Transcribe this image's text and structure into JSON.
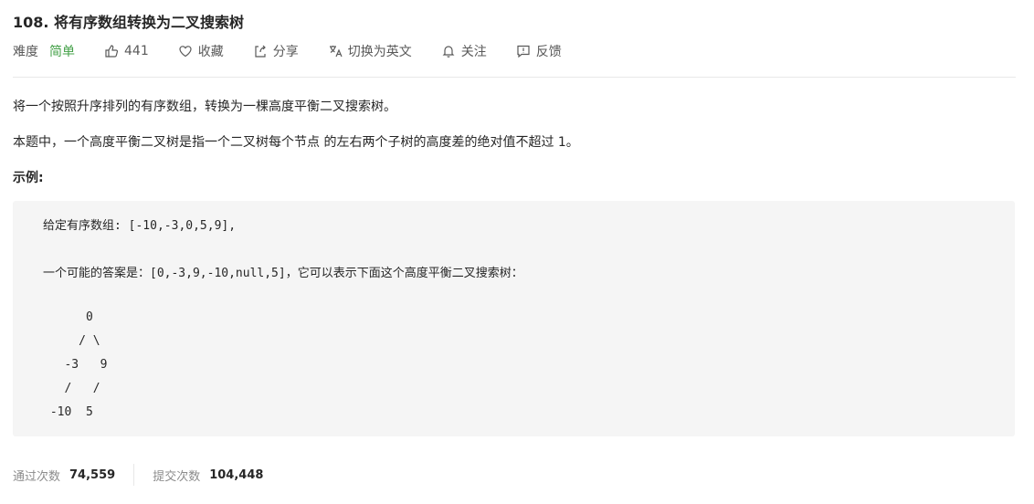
{
  "problem": {
    "title": "108. 将有序数组转换为二叉搜索树"
  },
  "meta": {
    "difficulty_label": "难度",
    "difficulty_value": "简单",
    "likes": "441",
    "favorite": "收藏",
    "share": "分享",
    "switch_lang": "切换为英文",
    "follow": "关注",
    "feedback": "反馈",
    "difficulty_color": "#43a047"
  },
  "description": {
    "line1": "将一个按照升序排列的有序数组，转换为一棵高度平衡二叉搜索树。",
    "line2": "本题中，一个高度平衡二叉树是指一个二叉树每个节点 的左右两个子树的高度差的绝对值不超过 1。"
  },
  "example": {
    "heading": "示例:",
    "given": "给定有序数组: [-10,-3,0,5,9],",
    "answer": "一个可能的答案是：[0,-3,9,-10,null,5]，它可以表示下面这个高度平衡二叉搜索树：",
    "tree": [
      "      0",
      "     / \\",
      "   -3   9",
      "   /   /",
      " -10  5"
    ]
  },
  "stats": {
    "accepted_label": "通过次数",
    "accepted_value": "74,559",
    "submitted_label": "提交次数",
    "submitted_value": "104,448"
  },
  "icons": {
    "like": "thumbs-up-icon",
    "favorite": "heart-icon",
    "share": "share-icon",
    "translate": "translate-icon",
    "follow": "bell-icon",
    "feedback": "feedback-icon"
  }
}
